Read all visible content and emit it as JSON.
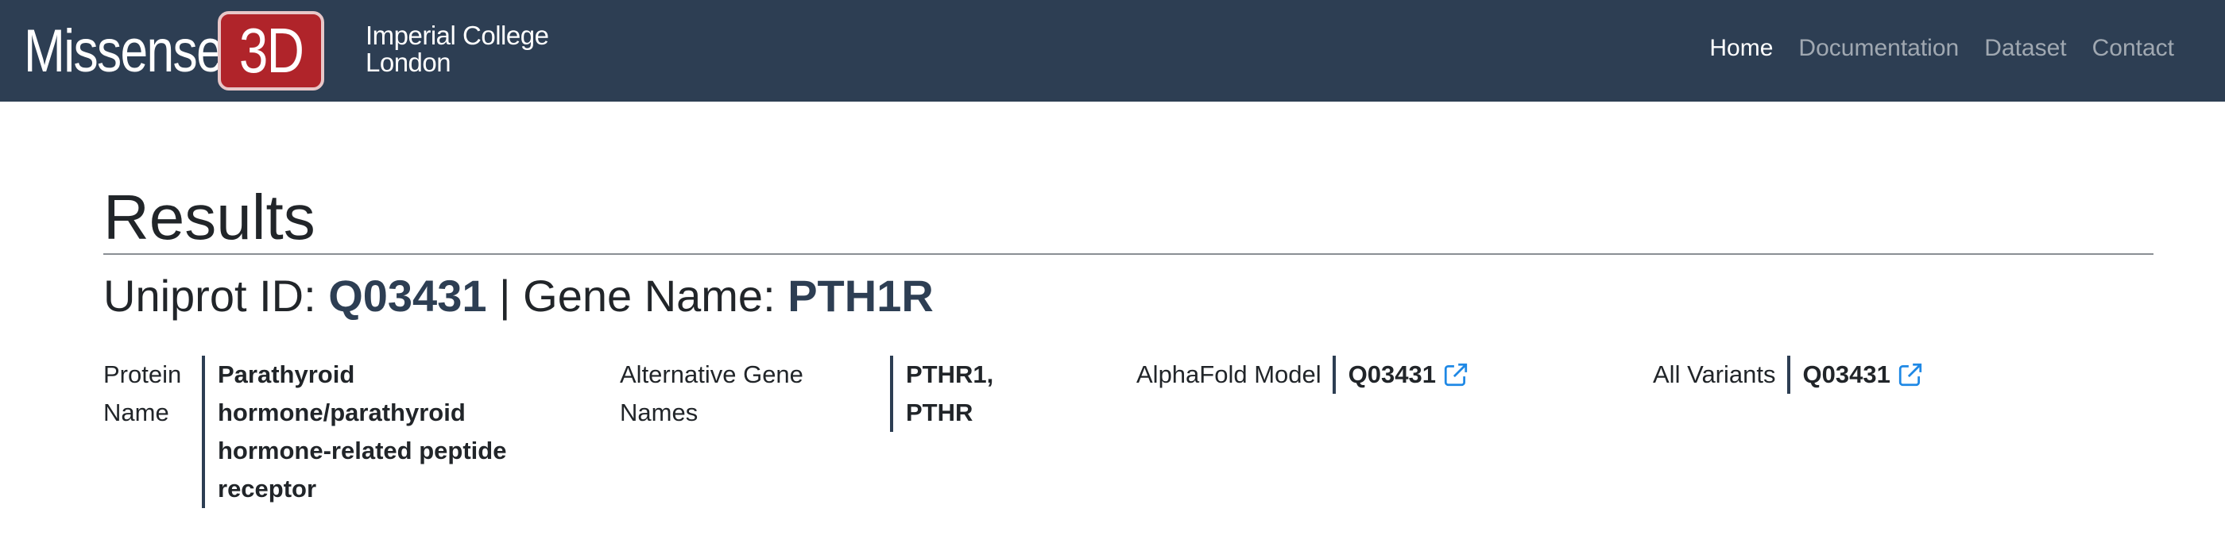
{
  "navbar": {
    "brand_word": "Missense",
    "brand_badge": "3D",
    "institution_line1": "Imperial College",
    "institution_line2": "London",
    "links": [
      {
        "label": "Home",
        "active": true
      },
      {
        "label": "Documentation",
        "active": false
      },
      {
        "label": "Dataset",
        "active": false
      },
      {
        "label": "Contact",
        "active": false
      }
    ]
  },
  "page": {
    "title": "Results",
    "subtitle_prefix_1": "Uniprot ID: ",
    "uniprot_id": "Q03431",
    "subtitle_sep": " | Gene Name: ",
    "gene_name": "PTH1R"
  },
  "info": {
    "protein_name_label_line1": "Protein",
    "protein_name_label_line2": "Name",
    "protein_name_line1": "Parathyroid",
    "protein_name_line2": "hormone/parathyroid",
    "protein_name_line3": "hormone-related peptide",
    "protein_name_line4": "receptor",
    "alt_gene_label_line1": "Alternative Gene",
    "alt_gene_label_line2": "Names",
    "alt_gene_line1": "PTHR1,",
    "alt_gene_line2": "PTHR",
    "alphafold_label": "AlphaFold Model",
    "alphafold_value": "Q03431",
    "all_variants_label": "All Variants",
    "all_variants_value": "Q03431"
  },
  "icons": {
    "external_link": "external-link-icon"
  },
  "colors": {
    "navbar_bg": "#2d3e53",
    "badge_bg": "#b0242a",
    "accent": "#2d3e53",
    "link_icon": "#1e88e5"
  }
}
